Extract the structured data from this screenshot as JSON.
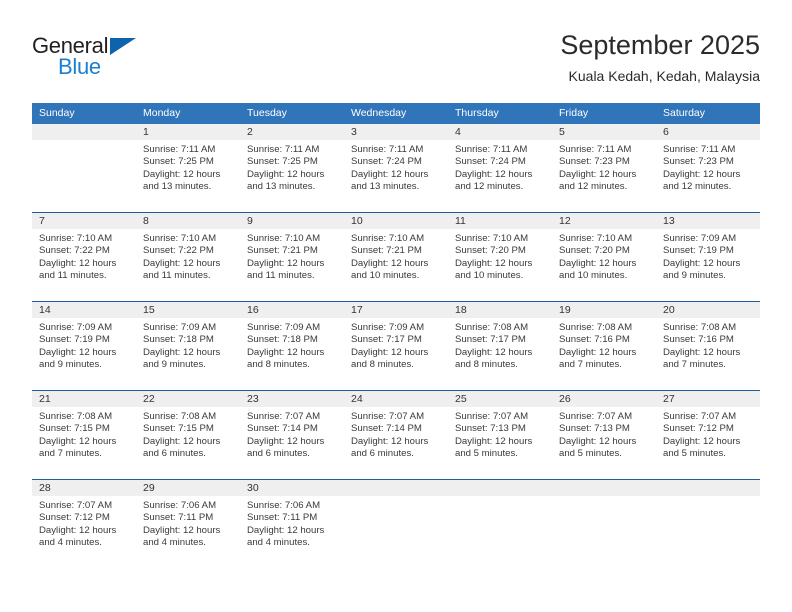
{
  "brand": {
    "name_top": "General",
    "name_bottom": "Blue",
    "accent_color": "#1b7fd4",
    "triangle_color": "#0e63ad"
  },
  "header": {
    "title": "September 2025",
    "subtitle": "Kuala Kedah, Kedah, Malaysia"
  },
  "theme": {
    "header_row_bg": "#3075ba",
    "week_divider": "#1f5d9c",
    "daynum_band_bg": "#efefef"
  },
  "weekdays": [
    "Sunday",
    "Monday",
    "Tuesday",
    "Wednesday",
    "Thursday",
    "Friday",
    "Saturday"
  ],
  "weeks": [
    [
      {
        "day": "",
        "lines": []
      },
      {
        "day": "1",
        "lines": [
          "Sunrise: 7:11 AM",
          "Sunset: 7:25 PM",
          "Daylight: 12 hours",
          "and 13 minutes."
        ]
      },
      {
        "day": "2",
        "lines": [
          "Sunrise: 7:11 AM",
          "Sunset: 7:25 PM",
          "Daylight: 12 hours",
          "and 13 minutes."
        ]
      },
      {
        "day": "3",
        "lines": [
          "Sunrise: 7:11 AM",
          "Sunset: 7:24 PM",
          "Daylight: 12 hours",
          "and 13 minutes."
        ]
      },
      {
        "day": "4",
        "lines": [
          "Sunrise: 7:11 AM",
          "Sunset: 7:24 PM",
          "Daylight: 12 hours",
          "and 12 minutes."
        ]
      },
      {
        "day": "5",
        "lines": [
          "Sunrise: 7:11 AM",
          "Sunset: 7:23 PM",
          "Daylight: 12 hours",
          "and 12 minutes."
        ]
      },
      {
        "day": "6",
        "lines": [
          "Sunrise: 7:11 AM",
          "Sunset: 7:23 PM",
          "Daylight: 12 hours",
          "and 12 minutes."
        ]
      }
    ],
    [
      {
        "day": "7",
        "lines": [
          "Sunrise: 7:10 AM",
          "Sunset: 7:22 PM",
          "Daylight: 12 hours",
          "and 11 minutes."
        ]
      },
      {
        "day": "8",
        "lines": [
          "Sunrise: 7:10 AM",
          "Sunset: 7:22 PM",
          "Daylight: 12 hours",
          "and 11 minutes."
        ]
      },
      {
        "day": "9",
        "lines": [
          "Sunrise: 7:10 AM",
          "Sunset: 7:21 PM",
          "Daylight: 12 hours",
          "and 11 minutes."
        ]
      },
      {
        "day": "10",
        "lines": [
          "Sunrise: 7:10 AM",
          "Sunset: 7:21 PM",
          "Daylight: 12 hours",
          "and 10 minutes."
        ]
      },
      {
        "day": "11",
        "lines": [
          "Sunrise: 7:10 AM",
          "Sunset: 7:20 PM",
          "Daylight: 12 hours",
          "and 10 minutes."
        ]
      },
      {
        "day": "12",
        "lines": [
          "Sunrise: 7:10 AM",
          "Sunset: 7:20 PM",
          "Daylight: 12 hours",
          "and 10 minutes."
        ]
      },
      {
        "day": "13",
        "lines": [
          "Sunrise: 7:09 AM",
          "Sunset: 7:19 PM",
          "Daylight: 12 hours",
          "and 9 minutes."
        ]
      }
    ],
    [
      {
        "day": "14",
        "lines": [
          "Sunrise: 7:09 AM",
          "Sunset: 7:19 PM",
          "Daylight: 12 hours",
          "and 9 minutes."
        ]
      },
      {
        "day": "15",
        "lines": [
          "Sunrise: 7:09 AM",
          "Sunset: 7:18 PM",
          "Daylight: 12 hours",
          "and 9 minutes."
        ]
      },
      {
        "day": "16",
        "lines": [
          "Sunrise: 7:09 AM",
          "Sunset: 7:18 PM",
          "Daylight: 12 hours",
          "and 8 minutes."
        ]
      },
      {
        "day": "17",
        "lines": [
          "Sunrise: 7:09 AM",
          "Sunset: 7:17 PM",
          "Daylight: 12 hours",
          "and 8 minutes."
        ]
      },
      {
        "day": "18",
        "lines": [
          "Sunrise: 7:08 AM",
          "Sunset: 7:17 PM",
          "Daylight: 12 hours",
          "and 8 minutes."
        ]
      },
      {
        "day": "19",
        "lines": [
          "Sunrise: 7:08 AM",
          "Sunset: 7:16 PM",
          "Daylight: 12 hours",
          "and 7 minutes."
        ]
      },
      {
        "day": "20",
        "lines": [
          "Sunrise: 7:08 AM",
          "Sunset: 7:16 PM",
          "Daylight: 12 hours",
          "and 7 minutes."
        ]
      }
    ],
    [
      {
        "day": "21",
        "lines": [
          "Sunrise: 7:08 AM",
          "Sunset: 7:15 PM",
          "Daylight: 12 hours",
          "and 7 minutes."
        ]
      },
      {
        "day": "22",
        "lines": [
          "Sunrise: 7:08 AM",
          "Sunset: 7:15 PM",
          "Daylight: 12 hours",
          "and 6 minutes."
        ]
      },
      {
        "day": "23",
        "lines": [
          "Sunrise: 7:07 AM",
          "Sunset: 7:14 PM",
          "Daylight: 12 hours",
          "and 6 minutes."
        ]
      },
      {
        "day": "24",
        "lines": [
          "Sunrise: 7:07 AM",
          "Sunset: 7:14 PM",
          "Daylight: 12 hours",
          "and 6 minutes."
        ]
      },
      {
        "day": "25",
        "lines": [
          "Sunrise: 7:07 AM",
          "Sunset: 7:13 PM",
          "Daylight: 12 hours",
          "and 5 minutes."
        ]
      },
      {
        "day": "26",
        "lines": [
          "Sunrise: 7:07 AM",
          "Sunset: 7:13 PM",
          "Daylight: 12 hours",
          "and 5 minutes."
        ]
      },
      {
        "day": "27",
        "lines": [
          "Sunrise: 7:07 AM",
          "Sunset: 7:12 PM",
          "Daylight: 12 hours",
          "and 5 minutes."
        ]
      }
    ],
    [
      {
        "day": "28",
        "lines": [
          "Sunrise: 7:07 AM",
          "Sunset: 7:12 PM",
          "Daylight: 12 hours",
          "and 4 minutes."
        ]
      },
      {
        "day": "29",
        "lines": [
          "Sunrise: 7:06 AM",
          "Sunset: 7:11 PM",
          "Daylight: 12 hours",
          "and 4 minutes."
        ]
      },
      {
        "day": "30",
        "lines": [
          "Sunrise: 7:06 AM",
          "Sunset: 7:11 PM",
          "Daylight: 12 hours",
          "and 4 minutes."
        ]
      },
      {
        "day": "",
        "lines": []
      },
      {
        "day": "",
        "lines": []
      },
      {
        "day": "",
        "lines": []
      },
      {
        "day": "",
        "lines": []
      }
    ]
  ]
}
